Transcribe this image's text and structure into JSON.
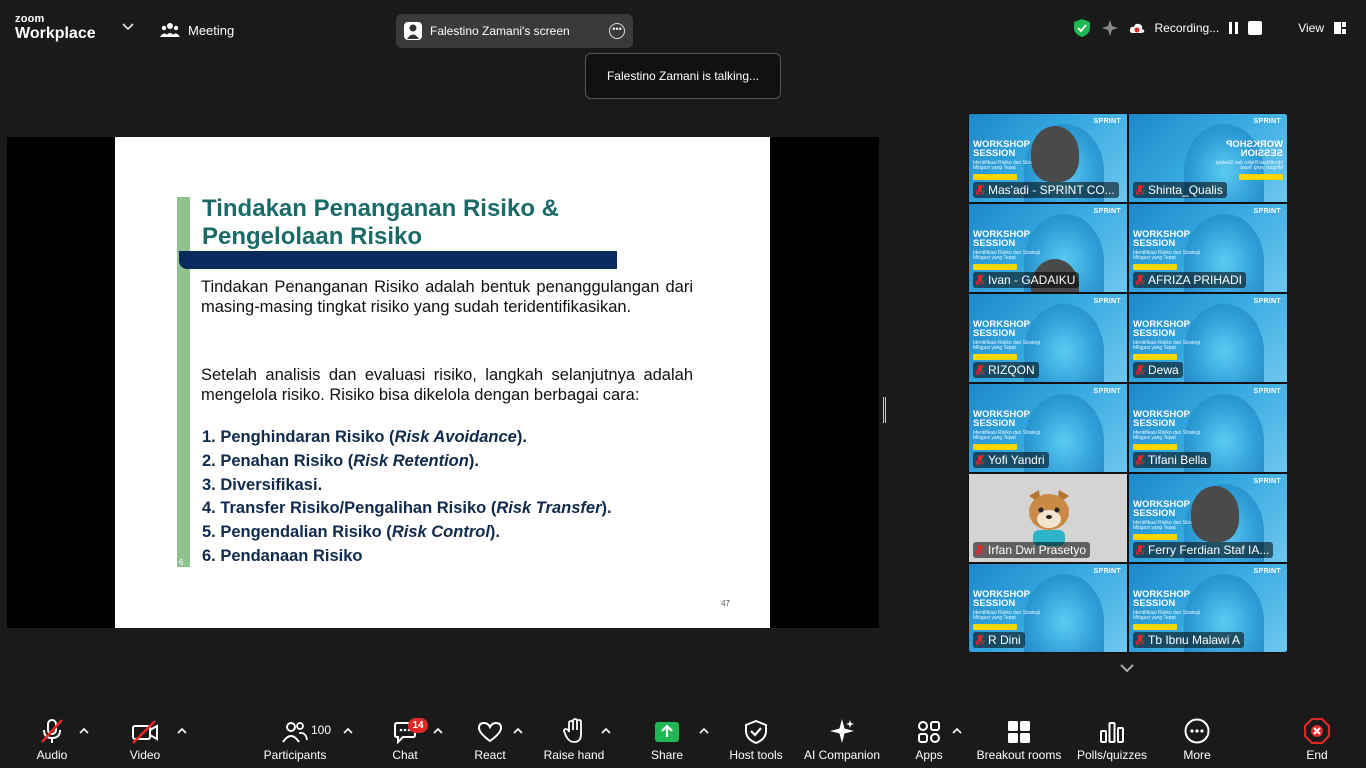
{
  "topbar": {
    "logo_line1": "zoom",
    "logo_line2": "Workplace",
    "meeting_label": "Meeting",
    "screen_share_title": "Falestino Zamani's screen",
    "talking_notice": "Falestino Zamani is talking...",
    "recording_label": "Recording...",
    "view_label": "View"
  },
  "slide": {
    "title": "Tindakan Penanganan Risiko & Pengelolaan Risiko",
    "paragraph1": "Tindakan Penanganan Risiko adalah bentuk penanggulangan dari masing-masing tingkat risiko yang sudah teridentifikasikan.",
    "paragraph2": "Setelah analisis dan evaluasi risiko, langkah selanjutnya adalah mengelola risiko. Risiko bisa dikelola dengan berbagai cara:",
    "items": [
      {
        "text": "1. Penghindaran Risiko (",
        "em": "Risk Avoidance",
        "tail": ")."
      },
      {
        "text": "2. Penahan Risiko (",
        "em": "Risk Retention",
        "tail": ")."
      },
      {
        "text": "3. Diversifikasi.",
        "em": "",
        "tail": ""
      },
      {
        "text": "4. Transfer Risiko/Pengalihan Risiko (",
        "em": "Risk Transfer",
        "tail": ")."
      },
      {
        "text": "5. Pengendalian Risiko (",
        "em": "Risk Control",
        "tail": ")."
      },
      {
        "text": "6. Pendanaan Risiko",
        "em": "",
        "tail": ""
      }
    ],
    "page_number": "47",
    "side_number": "6"
  },
  "tile_text": {
    "workshop": "WORKSHOP",
    "session": "SESSION",
    "brand": "SPRINT",
    "subtitle": "Identifikasi Risiko dan Strategi Mitigasi yang Tepat"
  },
  "participants": [
    {
      "name": "Mas'adi - SPRINT CO...",
      "kind": "camera"
    },
    {
      "name": "Shinta_Qualis",
      "kind": "mirrored"
    },
    {
      "name": "Ivan - GADAIKU",
      "kind": "camera"
    },
    {
      "name": "AFRIZA PRIHADI",
      "kind": "banner"
    },
    {
      "name": "RIZQON",
      "kind": "banner"
    },
    {
      "name": "Dewa",
      "kind": "banner"
    },
    {
      "name": "Yofi Yandri",
      "kind": "banner"
    },
    {
      "name": "Tifani Bella",
      "kind": "banner"
    },
    {
      "name": "Irfan Dwi Prasetyo",
      "kind": "avatar"
    },
    {
      "name": "Ferry Ferdian Staf IA...",
      "kind": "camera"
    },
    {
      "name": "R Dini",
      "kind": "banner"
    },
    {
      "name": "Tb Ibnu Malawi A",
      "kind": "banner"
    }
  ],
  "toolbar": {
    "audio": "Audio",
    "video": "Video",
    "participants": "Participants",
    "participants_count": "100",
    "chat": "Chat",
    "chat_badge": "14",
    "react": "React",
    "raise_hand": "Raise hand",
    "share": "Share",
    "host_tools": "Host tools",
    "ai_companion": "AI Companion",
    "apps": "Apps",
    "breakout_rooms": "Breakout rooms",
    "polls": "Polls/quizzes",
    "more": "More",
    "end": "End"
  },
  "colors": {
    "share_green": "#1fb855",
    "end_red": "#e02828",
    "slide_title_teal": "#1a6b68",
    "slide_navy": "#0a2a5e",
    "muted_red": "#e02828"
  }
}
